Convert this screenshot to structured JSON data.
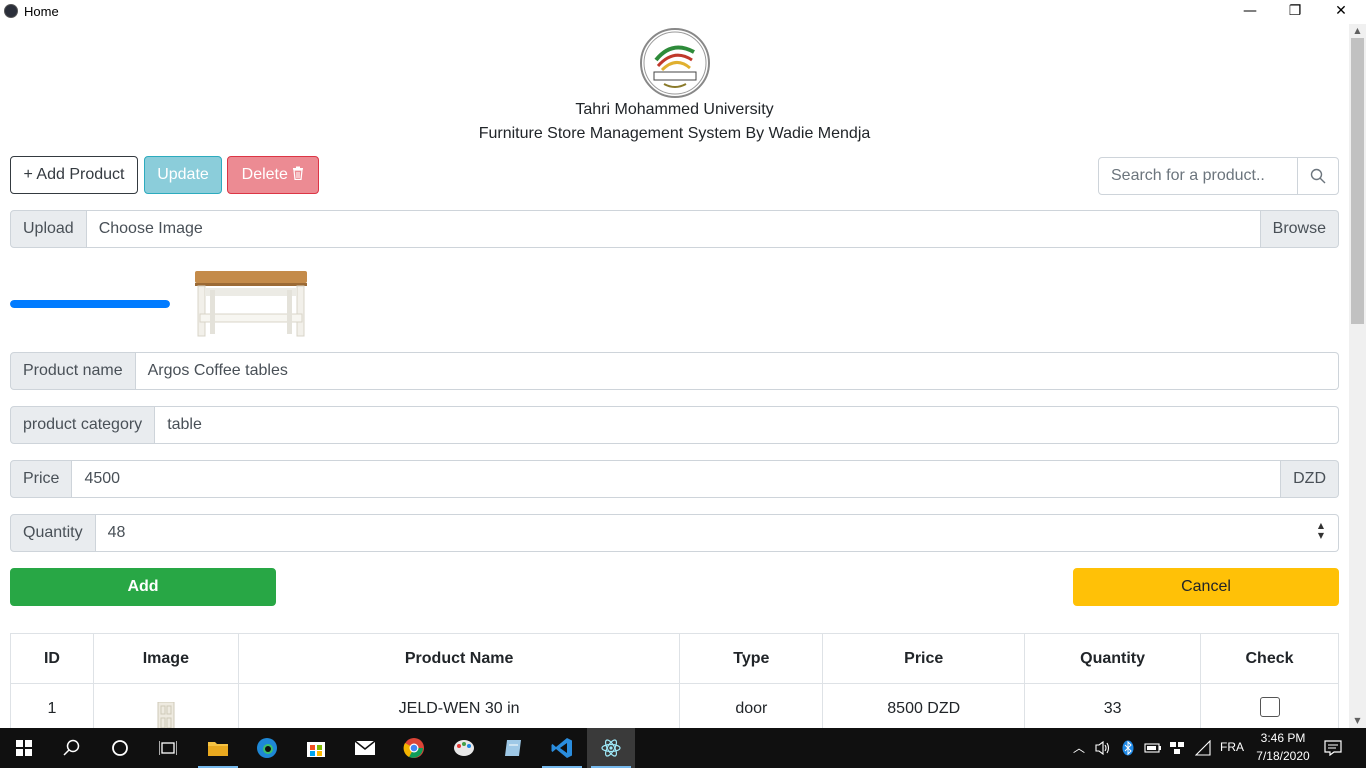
{
  "window": {
    "title": "Home",
    "minimize": "—",
    "maximize": "❐",
    "close": "✕"
  },
  "header": {
    "university": "Tahri Mohammed University",
    "subtitle": "Furniture Store Management System By Wadie Mendja"
  },
  "toolbar": {
    "add_label": "+ Add Product",
    "update_label": "Update",
    "delete_label": "Delete",
    "delete_icon": "trash-icon"
  },
  "search": {
    "placeholder": "Search for a product..",
    "icon": "search-icon"
  },
  "upload": {
    "label": "Upload",
    "file_text": "Choose Image",
    "browse_label": "Browse",
    "progress_percent": 100
  },
  "form": {
    "product_name_label": "Product name",
    "product_name_value": "Argos Coffee tables",
    "category_label": "product category",
    "category_value": "table",
    "price_label": "Price",
    "price_value": "4500",
    "price_unit": "DZD",
    "quantity_label": "Quantity",
    "quantity_value": "48",
    "add_label": "Add",
    "cancel_label": "Cancel"
  },
  "table": {
    "headers": [
      "ID",
      "Image",
      "Product Name",
      "Type",
      "Price",
      "Quantity",
      "Check"
    ],
    "rows": [
      {
        "id": "1",
        "name": "JELD-WEN 30 in",
        "type": "door",
        "price": "8500 DZD",
        "quantity": "33"
      }
    ]
  },
  "taskbar": {
    "time": "3:46 PM",
    "date": "7/18/2020",
    "language": "FRA"
  },
  "colors": {
    "primary": "#007bff",
    "success": "#28a745",
    "warning": "#ffc107",
    "info": "#17a2b8",
    "danger": "#dc3545"
  }
}
